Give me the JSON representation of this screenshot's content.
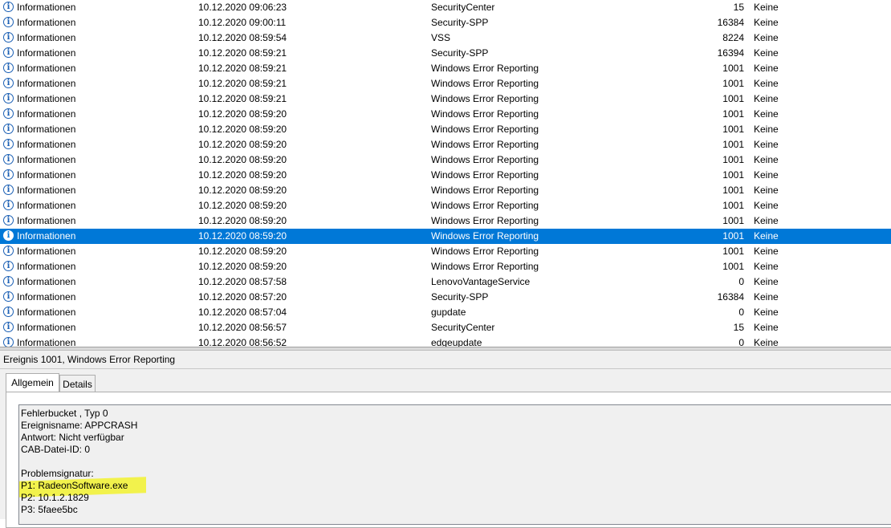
{
  "events": [
    {
      "level": "Informationen",
      "date": "10.12.2020 09:06:23",
      "source": "SecurityCenter",
      "id": "15",
      "category": "Keine"
    },
    {
      "level": "Informationen",
      "date": "10.12.2020 09:00:11",
      "source": "Security-SPP",
      "id": "16384",
      "category": "Keine"
    },
    {
      "level": "Informationen",
      "date": "10.12.2020 08:59:54",
      "source": "VSS",
      "id": "8224",
      "category": "Keine"
    },
    {
      "level": "Informationen",
      "date": "10.12.2020 08:59:21",
      "source": "Security-SPP",
      "id": "16394",
      "category": "Keine"
    },
    {
      "level": "Informationen",
      "date": "10.12.2020 08:59:21",
      "source": "Windows Error Reporting",
      "id": "1001",
      "category": "Keine"
    },
    {
      "level": "Informationen",
      "date": "10.12.2020 08:59:21",
      "source": "Windows Error Reporting",
      "id": "1001",
      "category": "Keine"
    },
    {
      "level": "Informationen",
      "date": "10.12.2020 08:59:21",
      "source": "Windows Error Reporting",
      "id": "1001",
      "category": "Keine"
    },
    {
      "level": "Informationen",
      "date": "10.12.2020 08:59:20",
      "source": "Windows Error Reporting",
      "id": "1001",
      "category": "Keine"
    },
    {
      "level": "Informationen",
      "date": "10.12.2020 08:59:20",
      "source": "Windows Error Reporting",
      "id": "1001",
      "category": "Keine"
    },
    {
      "level": "Informationen",
      "date": "10.12.2020 08:59:20",
      "source": "Windows Error Reporting",
      "id": "1001",
      "category": "Keine"
    },
    {
      "level": "Informationen",
      "date": "10.12.2020 08:59:20",
      "source": "Windows Error Reporting",
      "id": "1001",
      "category": "Keine"
    },
    {
      "level": "Informationen",
      "date": "10.12.2020 08:59:20",
      "source": "Windows Error Reporting",
      "id": "1001",
      "category": "Keine"
    },
    {
      "level": "Informationen",
      "date": "10.12.2020 08:59:20",
      "source": "Windows Error Reporting",
      "id": "1001",
      "category": "Keine"
    },
    {
      "level": "Informationen",
      "date": "10.12.2020 08:59:20",
      "source": "Windows Error Reporting",
      "id": "1001",
      "category": "Keine"
    },
    {
      "level": "Informationen",
      "date": "10.12.2020 08:59:20",
      "source": "Windows Error Reporting",
      "id": "1001",
      "category": "Keine"
    },
    {
      "level": "Informationen",
      "date": "10.12.2020 08:59:20",
      "source": "Windows Error Reporting",
      "id": "1001",
      "category": "Keine",
      "selected": true
    },
    {
      "level": "Informationen",
      "date": "10.12.2020 08:59:20",
      "source": "Windows Error Reporting",
      "id": "1001",
      "category": "Keine"
    },
    {
      "level": "Informationen",
      "date": "10.12.2020 08:59:20",
      "source": "Windows Error Reporting",
      "id": "1001",
      "category": "Keine"
    },
    {
      "level": "Informationen",
      "date": "10.12.2020 08:57:58",
      "source": "LenovoVantageService",
      "id": "0",
      "category": "Keine"
    },
    {
      "level": "Informationen",
      "date": "10.12.2020 08:57:20",
      "source": "Security-SPP",
      "id": "16384",
      "category": "Keine"
    },
    {
      "level": "Informationen",
      "date": "10.12.2020 08:57:04",
      "source": "gupdate",
      "id": "0",
      "category": "Keine"
    },
    {
      "level": "Informationen",
      "date": "10.12.2020 08:56:57",
      "source": "SecurityCenter",
      "id": "15",
      "category": "Keine"
    },
    {
      "level": "Informationen",
      "date": "10.12.2020 08:56:52",
      "source": "edgeupdate",
      "id": "0",
      "category": "Keine"
    }
  ],
  "icons": {
    "info": "information-icon"
  },
  "colors": {
    "selection": "#0078d7",
    "highlight": "#f2f23a"
  },
  "details": {
    "title": "Ereignis 1001, Windows Error Reporting",
    "tabs": {
      "general": "Allgemein",
      "details": "Details"
    },
    "lines": [
      "Fehlerbucket , Typ 0",
      "Ereignisname: APPCRASH",
      "Antwort: Nicht verfügbar",
      "CAB-Datei-ID: 0",
      "",
      "Problemsignatur:",
      "P1: RadeonSoftware.exe",
      "P2: 10.1.2.1829",
      "P3: 5faee5bc"
    ],
    "highlighted_line": 6
  }
}
